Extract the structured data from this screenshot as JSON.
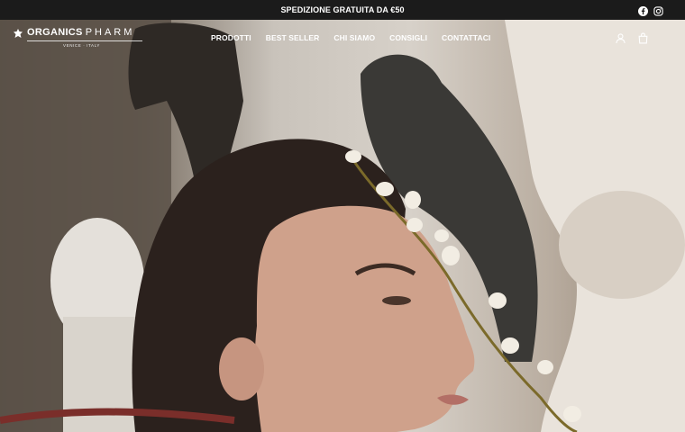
{
  "topbar": {
    "promo_text": "SPEDIZIONE GRATUITA DA €50",
    "social_icons": [
      "facebook-icon",
      "instagram-icon"
    ]
  },
  "header": {
    "logo": {
      "brand": "ORGANICS",
      "brand_suffix": "PHARM",
      "tagline": "VENICE · ITALY"
    },
    "nav": [
      "PRODOTTI",
      "BEST SELLER",
      "CHI SIAMO",
      "CONSIGLI",
      "CONTATTACI"
    ],
    "icons": [
      "user-icon",
      "shopping-bag-icon"
    ]
  },
  "colors": {
    "topbar_bg": "#1b1b1b",
    "text": "#ffffff"
  }
}
